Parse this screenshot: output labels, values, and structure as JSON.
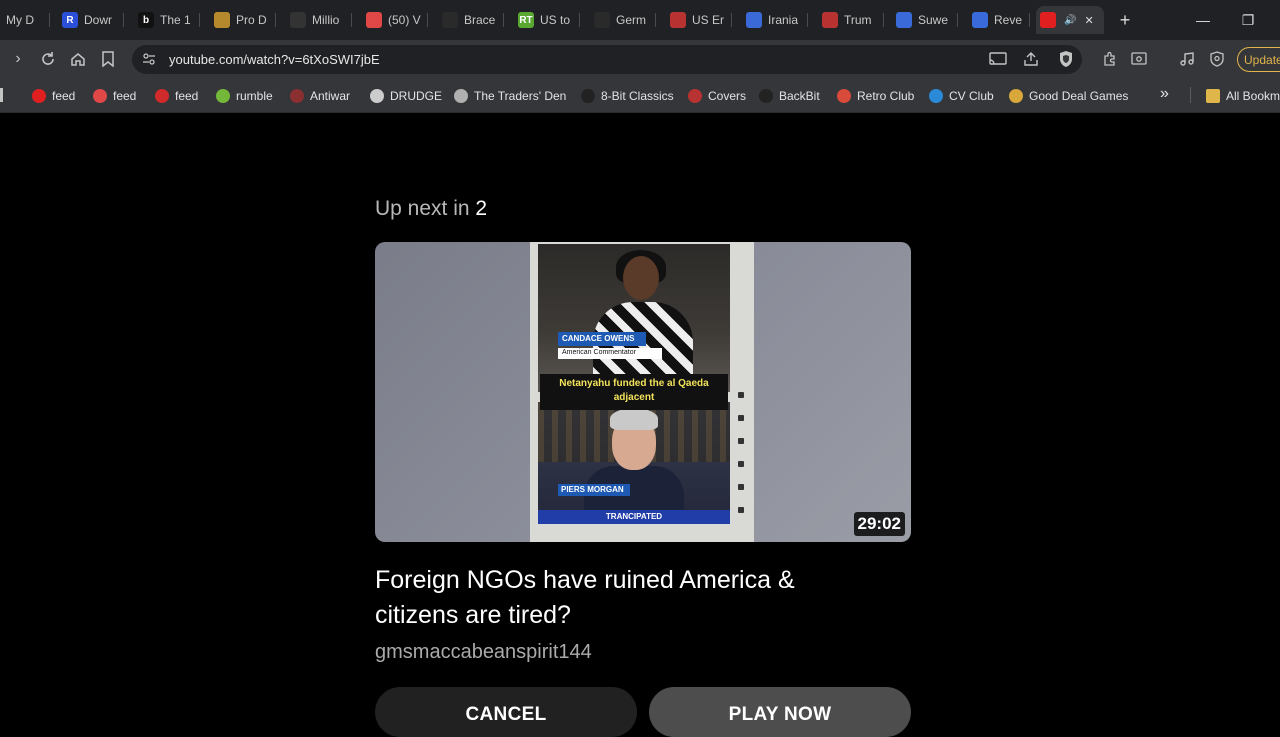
{
  "browser": {
    "tabs": [
      {
        "label": "My D",
        "favicon_text": "",
        "favicon_color": "#202124"
      },
      {
        "label": "Dowr",
        "favicon_text": "R",
        "favicon_color": "#2b4fd8"
      },
      {
        "label": "The 1",
        "favicon_text": "b",
        "favicon_color": "#111111"
      },
      {
        "label": "Pro D",
        "favicon_text": "",
        "favicon_color": "#b48a2c"
      },
      {
        "label": "Millio",
        "favicon_text": "",
        "favicon_color": "#333333"
      },
      {
        "label": "(50) V",
        "favicon_text": "",
        "favicon_color": "#e04848"
      },
      {
        "label": "Brace",
        "favicon_text": "",
        "favicon_color": "#2a2a2a"
      },
      {
        "label": "US to",
        "favicon_text": "RT",
        "favicon_color": "#5aa832"
      },
      {
        "label": "Germ",
        "favicon_text": "",
        "favicon_color": "#2a2a2a"
      },
      {
        "label": "US Er",
        "favicon_text": "",
        "favicon_color": "#b83232"
      },
      {
        "label": "Irania",
        "favicon_text": "",
        "favicon_color": "#3a6ad8"
      },
      {
        "label": "Trum",
        "favicon_text": "",
        "favicon_color": "#b83232"
      },
      {
        "label": "Suwe",
        "favicon_text": "",
        "favicon_color": "#3a6ad8"
      },
      {
        "label": "Reve",
        "favicon_text": "",
        "favicon_color": "#3a6ad8"
      },
      {
        "label": "",
        "favicon_text": "",
        "favicon_color": "#e02020"
      }
    ],
    "new_tab_symbol": "+",
    "window": {
      "minimize": "—",
      "restore": "❐"
    },
    "url": "youtube.com/watch?v=6tXoSWI7jbE",
    "update_label": "Update",
    "bookmarks": [
      {
        "label": "feed",
        "color": "#e02020"
      },
      {
        "label": "feed",
        "color": "#e04848"
      },
      {
        "label": "feed",
        "color": "#d02a2a"
      },
      {
        "label": "rumble",
        "color": "#74b83a"
      },
      {
        "label": "Antiwar",
        "color": "#8a3030"
      },
      {
        "label": "DRUDGE",
        "color": "#cccccc"
      },
      {
        "label": "The Traders' Den",
        "color": "#b0b0b0"
      },
      {
        "label": "8-Bit Classics",
        "color": "#222222"
      },
      {
        "label": "Covers",
        "color": "#b83232"
      },
      {
        "label": "BackBit",
        "color": "#222222"
      },
      {
        "label": "Retro Club",
        "color": "#d84a3a"
      },
      {
        "label": "CV Club",
        "color": "#2a8ad8"
      },
      {
        "label": "Good Deal Games",
        "color": "#d8a83a"
      }
    ],
    "more_bookmarks": "»",
    "all_bookmarks": "All Bookm"
  },
  "player": {
    "up_next_prefix": "Up next in",
    "up_next_count": "2",
    "thumbnail": {
      "name_strap": "CANDACE OWENS",
      "role_strap": "American Commentator",
      "caption": "Netanyahu funded the al Qaeda adjacent",
      "piers_strap": "PIERS MORGAN",
      "bottom_bar": "TRANCIPATED",
      "duration": "29:02"
    },
    "video_title": "Foreign NGOs have ruined America & citizens are tired?",
    "channel": "gmsmaccabeanspirit144",
    "cancel_label": "CANCEL",
    "play_now_label": "PLAY NOW"
  }
}
